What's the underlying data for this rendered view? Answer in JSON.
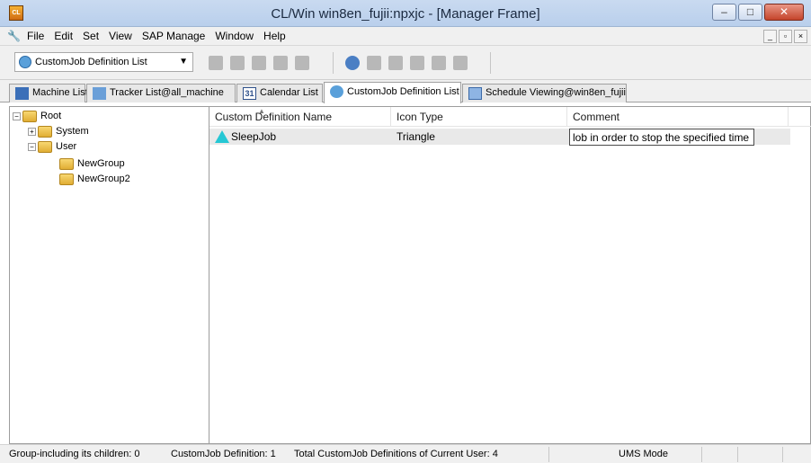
{
  "window": {
    "title": "CL/Win win8en_fujii:npxjc - [Manager Frame]",
    "app_icon_text": "CL"
  },
  "menu": {
    "items": [
      "File",
      "Edit",
      "Set",
      "View",
      "SAP Manage",
      "Window",
      "Help"
    ]
  },
  "toolbar": {
    "view_selector_value": "CustomJob Definition List"
  },
  "tabs": [
    {
      "label": "Machine List",
      "icon": "monitor-icon"
    },
    {
      "label": "Tracker List@all_machine",
      "icon": "tracker-icon"
    },
    {
      "label": "Calendar List",
      "icon": "calendar-icon",
      "icon_text": "31"
    },
    {
      "label": "CustomJob Definition List",
      "icon": "customjob-icon",
      "active": true
    },
    {
      "label": "Schedule Viewing@win8en_fujii",
      "icon": "schedule-icon"
    }
  ],
  "tree": {
    "root": "Root",
    "system": "System",
    "user": "User",
    "group1": "NewGroup",
    "group2": "NewGroup2"
  },
  "list": {
    "columns": [
      "Custom Definition Name",
      "Icon Type",
      "Comment"
    ],
    "rows": [
      {
        "name": "SleepJob",
        "icon_type": "Triangle",
        "comment": "lob in order to stop the specified time"
      }
    ]
  },
  "status": {
    "groups": "Group-including its children: 0",
    "definitions": "CustomJob Definition: 1",
    "total": "Total CustomJob Definitions of Current User: 4",
    "mode": "UMS Mode"
  },
  "colors": {
    "triangle_icon": "#25c7d4",
    "titlebar": "#c9daf0"
  }
}
